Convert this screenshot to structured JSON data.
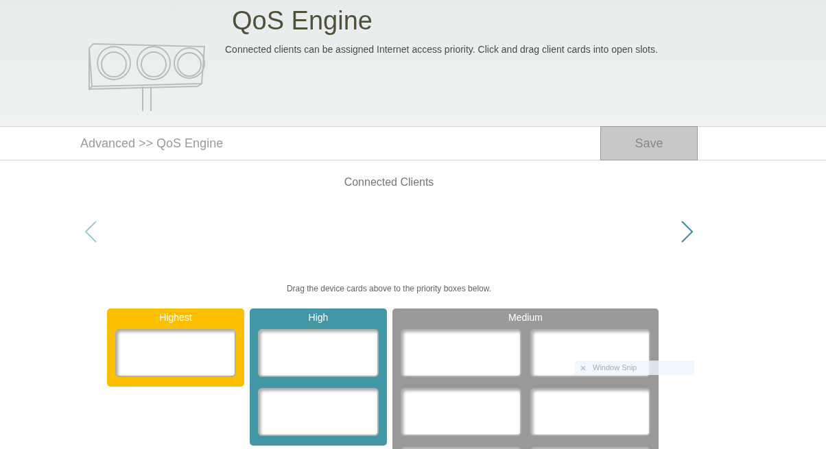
{
  "header": {
    "title": "QoS Engine",
    "description": "Connected clients can be assigned Internet access priority. Click and drag client cards into open slots."
  },
  "breadcrumb": "Advanced >> QoS Engine",
  "save_button": {
    "label": "Save",
    "disabled": true
  },
  "clients": {
    "title": "Connected Clients",
    "prev_disabled": true,
    "next_disabled": false
  },
  "hint": "Drag the device cards above to the priority boxes below.",
  "priorities": [
    {
      "label": "Highest",
      "color": "#fcbf00",
      "slots": [
        {
          "empty": true
        }
      ]
    },
    {
      "label": "High",
      "color": "#4396a6",
      "slots": [
        {
          "empty": true
        },
        {
          "empty": true
        }
      ]
    },
    {
      "label": "Medium",
      "color": "#999999",
      "slots": [
        {
          "empty": true
        },
        {
          "empty": true
        },
        {
          "empty": true
        },
        {
          "empty": true
        },
        {
          "empty": true
        },
        {
          "empty": true
        }
      ]
    }
  ],
  "tooltip": {
    "label": "Window Snip"
  }
}
